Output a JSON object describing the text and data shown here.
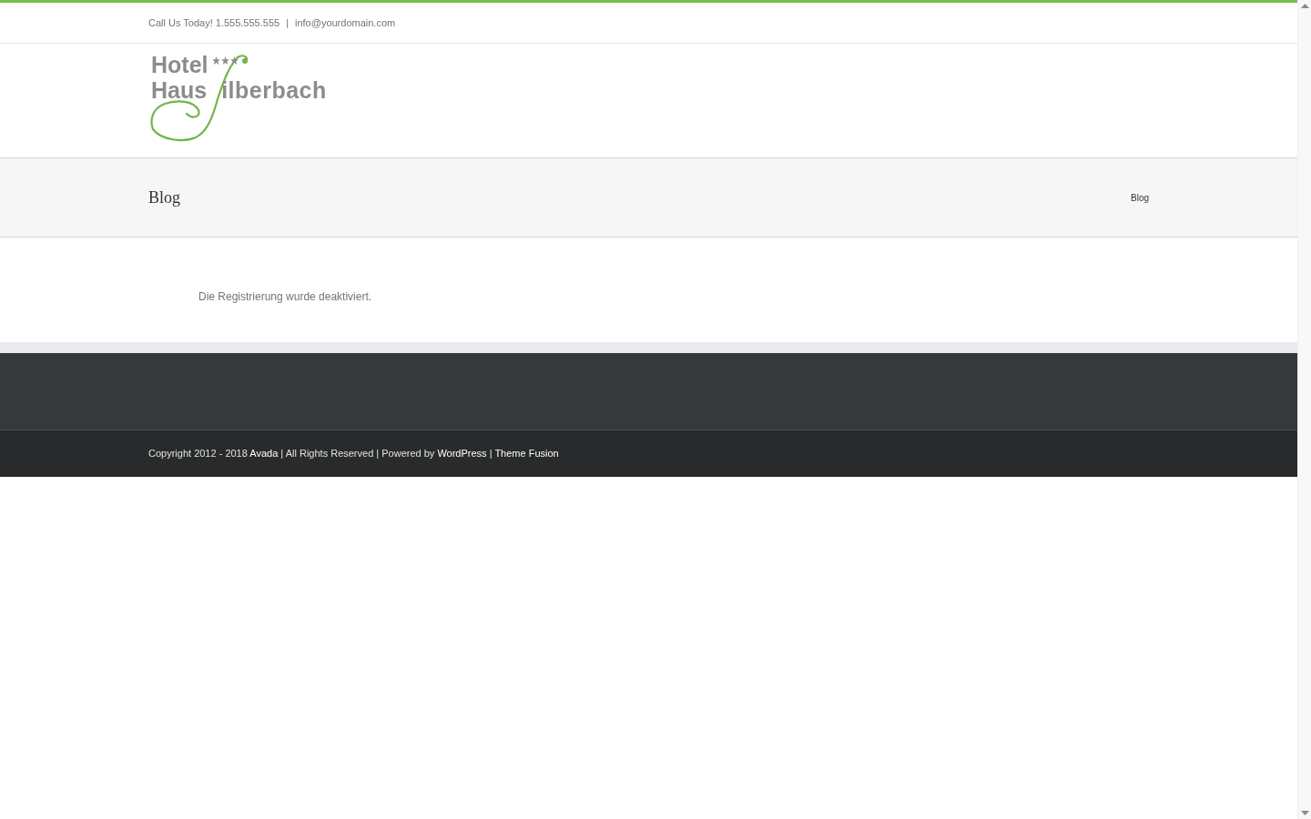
{
  "top_bar": {
    "phone": "Call Us Today! 1.555.555.555",
    "separator": "|",
    "email": "info@yourdomain.com"
  },
  "logo": {
    "line_1": "Hotel",
    "line_2_start": "Haus",
    "line_2_end": "ilberbach"
  },
  "page_title_bar": {
    "title": "Blog",
    "breadcrumb": "Blog"
  },
  "content": {
    "message": "Die Registrierung wurde deaktiviert."
  },
  "footer": {
    "copyright": [
      {
        "kind": "text",
        "text": "Copyright 2012 - 2018 "
      },
      {
        "kind": "link",
        "text": "Avada"
      },
      {
        "kind": "text",
        "text": " | All Rights Reserved | Powered by "
      },
      {
        "kind": "link",
        "text": "WordPress"
      },
      {
        "kind": "text",
        "text": " | "
      },
      {
        "kind": "link",
        "text": "Theme Fusion"
      }
    ]
  }
}
